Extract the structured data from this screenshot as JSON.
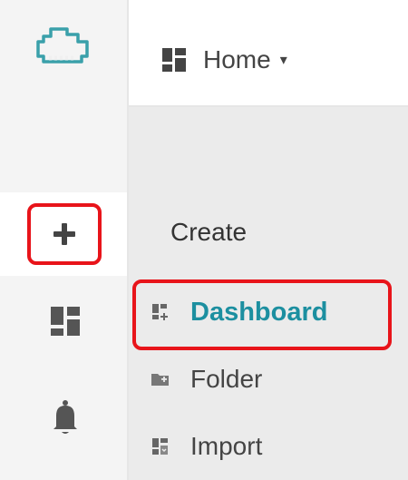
{
  "sidebar": {
    "logo_icon": "cloud-logo-icon",
    "items": [
      {
        "name": "create",
        "icon": "plus-icon",
        "active": true,
        "highlighted": true
      },
      {
        "name": "dashboards",
        "icon": "dashboard-grid-icon",
        "active": false
      },
      {
        "name": "alerts",
        "icon": "bell-icon",
        "active": false
      }
    ]
  },
  "topbar": {
    "home_label": "Home",
    "home_icon": "dashboard-grid-icon",
    "caret": "▾"
  },
  "create_menu": {
    "header": "Create",
    "items": [
      {
        "label": "Dashboard",
        "icon": "new-dashboard-icon",
        "highlighted": true
      },
      {
        "label": "Folder",
        "icon": "new-folder-icon"
      },
      {
        "label": "Import",
        "icon": "import-icon"
      }
    ]
  },
  "colors": {
    "highlight": "#e8141a",
    "accent": "#1c8fa0",
    "sidebar_bg": "#f4f4f4",
    "menu_bg": "#ebebeb"
  }
}
